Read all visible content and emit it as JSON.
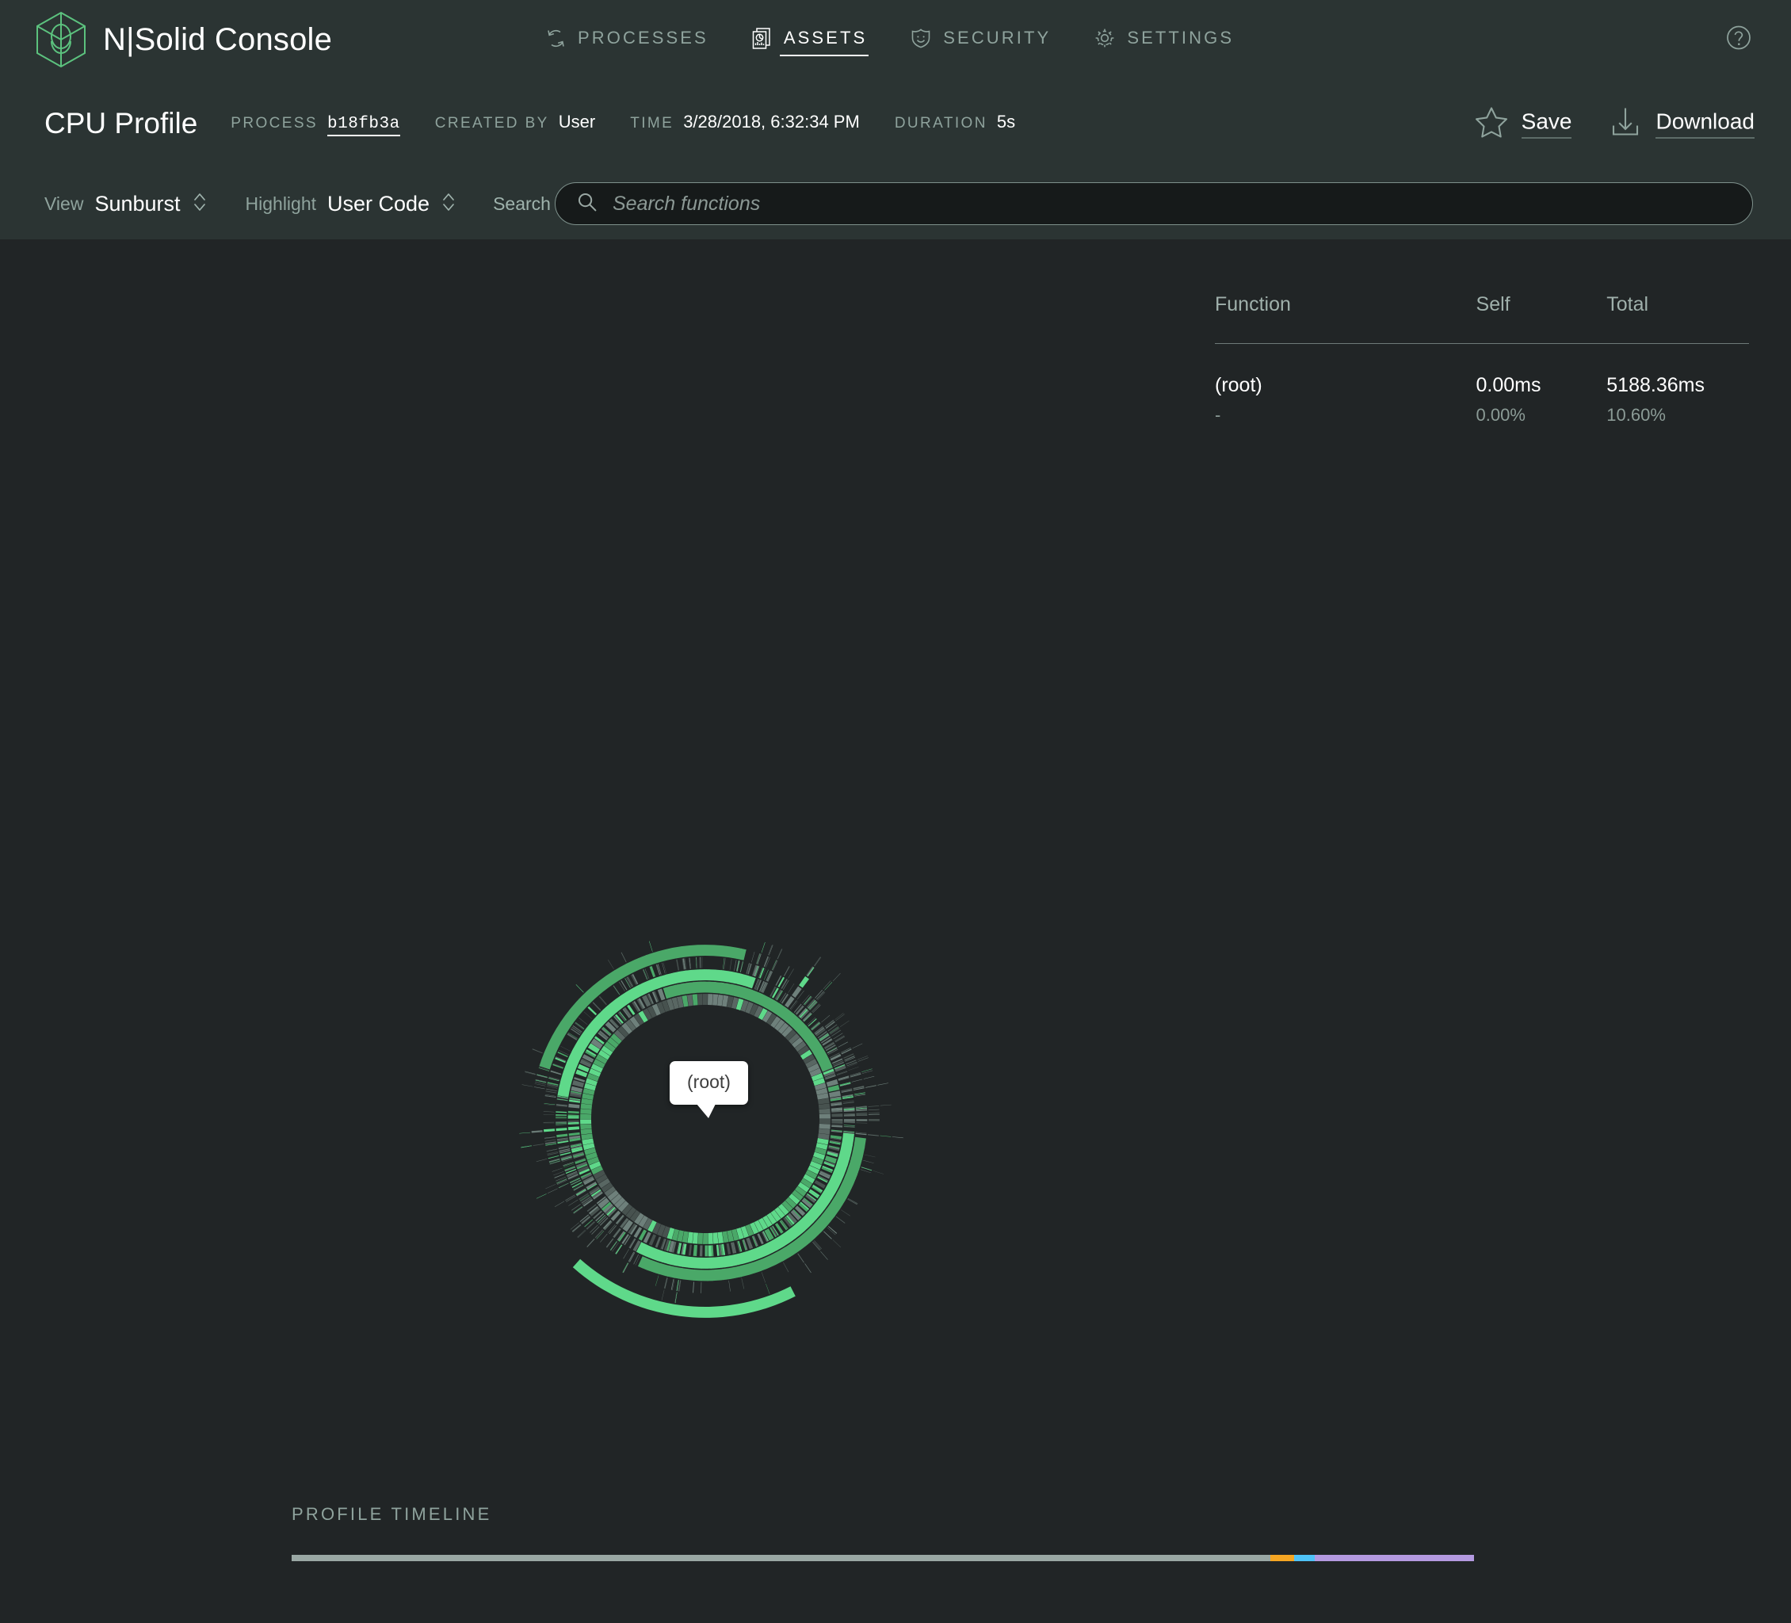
{
  "app": {
    "brand_name": "N|Solid Console",
    "logo_icon": "nsolid-cube-icon",
    "help_icon": "question-circle-icon"
  },
  "nav": {
    "items": [
      {
        "label": "PROCESSES",
        "icon": "refresh-cycle-icon",
        "active": false
      },
      {
        "label": "ASSETS",
        "icon": "documents-chart-icon",
        "active": true
      },
      {
        "label": "SECURITY",
        "icon": "shield-smiley-icon",
        "active": false
      },
      {
        "label": "SETTINGS",
        "icon": "gear-icon",
        "active": false
      }
    ]
  },
  "header": {
    "title": "CPU Profile",
    "meta": [
      {
        "key": "PROCESS",
        "value": "b18fb3a",
        "is_link": true
      },
      {
        "key": "CREATED BY",
        "value": "User",
        "is_link": false
      },
      {
        "key": "TIME",
        "value": "3/28/2018, 6:32:34 PM",
        "is_link": false
      },
      {
        "key": "DURATION",
        "value": "5s",
        "is_link": false
      }
    ],
    "actions": [
      {
        "label": "Save",
        "icon": "star-icon"
      },
      {
        "label": "Download",
        "icon": "download-arrow-icon"
      }
    ]
  },
  "toolbar": {
    "view_label": "View",
    "view_value": "Sunburst",
    "highlight_label": "Highlight",
    "highlight_value": "User Code",
    "search_label": "Search",
    "search_placeholder": "Search functions",
    "search_value": "",
    "search_icon": "magnifier-icon",
    "chevron_icon": "chevron-updown-icon"
  },
  "table": {
    "columns": [
      "Function",
      "Self",
      "Total"
    ],
    "rows": [
      {
        "function": "(root)",
        "function_sub": "-",
        "self": "0.00ms",
        "self_pct": "0.00%",
        "total": "5188.36ms",
        "total_pct": "10.60%"
      }
    ]
  },
  "sunburst": {
    "tooltip_label": "(root)",
    "center_label": "(root)",
    "root_ring_color": "#ef4f63",
    "user_code_color": "#5fd98a",
    "system_code_color": "#6e807b",
    "background": "#212526"
  },
  "timeline": {
    "title": "PROFILE TIMELINE",
    "segments": [
      {
        "name": "idle",
        "color": "#9aa8a4",
        "pct": 82.8
      },
      {
        "name": "orange-span",
        "color": "#f5a623",
        "pct": 2.0
      },
      {
        "name": "cyan-span",
        "color": "#4fc3f7",
        "pct": 1.7
      },
      {
        "name": "purple-span",
        "color": "#b49ae0",
        "pct": 13.5
      }
    ]
  },
  "colors": {
    "header_bg": "#2b3433",
    "body_bg": "#212526",
    "input_bg": "#161a1a",
    "muted_text": "#8fa39d",
    "accent_green": "#5cc27e",
    "white": "#ffffff"
  }
}
